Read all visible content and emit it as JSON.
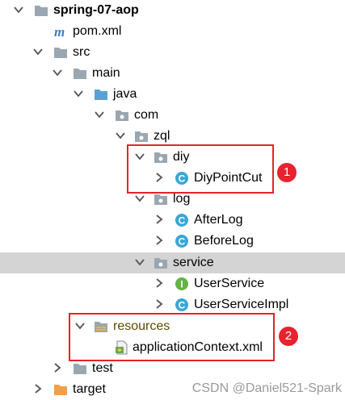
{
  "tree": {
    "project": "spring-07-aop",
    "pom": "pom.xml",
    "src": "src",
    "main": "main",
    "java": "java",
    "com": "com",
    "zql": "zql",
    "diy": "diy",
    "diy_pointcut": "DiyPointCut",
    "log": "log",
    "after_log": "AfterLog",
    "before_log": "BeforeLog",
    "service": "service",
    "user_service": "UserService",
    "user_service_impl": "UserServiceImpl",
    "resources": "resources",
    "app_context": "applicationContext.xml",
    "test": "test",
    "target": "target"
  },
  "annotations": {
    "badge1": "1",
    "badge2": "2"
  },
  "watermark": "CSDN @Daniel521-Spark",
  "icons": {
    "folder": "folder-icon",
    "package": "package-icon",
    "class": "class-icon",
    "interface": "interface-icon",
    "maven": "maven-icon",
    "xml": "spring-xml-icon"
  },
  "colors": {
    "selection": "#d4d4d4",
    "folder": "#9aa7b0",
    "source_folder": "#5aa0d6",
    "target_folder": "#f0a04b",
    "class": "#3aa6d6",
    "interface": "#62b543",
    "annotation_red": "#e0262b"
  }
}
